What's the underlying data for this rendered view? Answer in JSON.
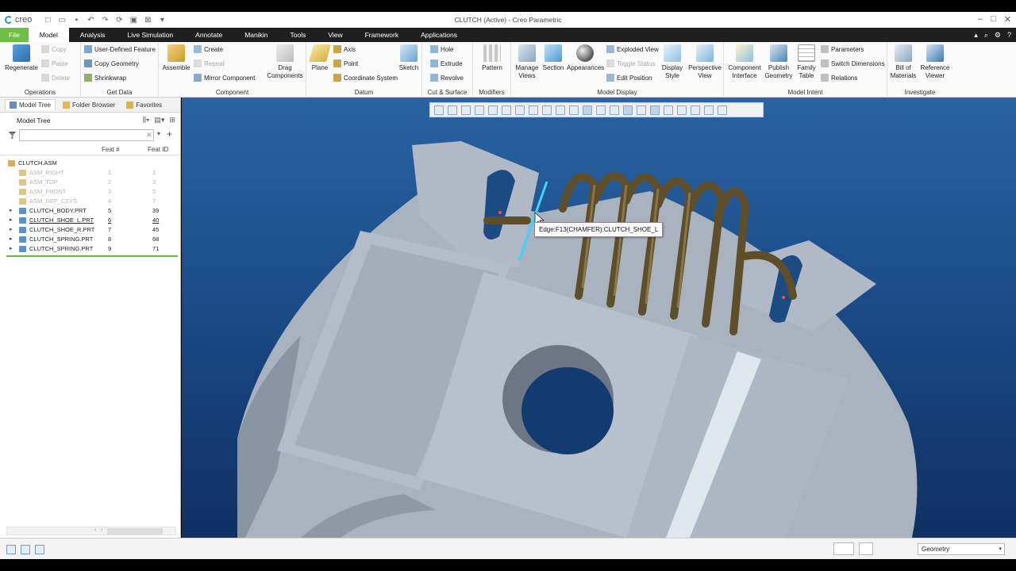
{
  "app": {
    "logo_text": "creo",
    "window_title": "CLUTCH (Active) - Creo Parametric"
  },
  "tabs": [
    "File",
    "Model",
    "Analysis",
    "Live Simulation",
    "Annotate",
    "Manikin",
    "Tools",
    "View",
    "Framework",
    "Applications"
  ],
  "active_tab": "Model",
  "ribbon": {
    "operations": {
      "label": "Operations",
      "regenerate": "Regenerate",
      "copy": "Copy",
      "paste": "Paste",
      "delete": "Delete"
    },
    "get_data": {
      "label": "Get Data",
      "udf": "User-Defined Feature",
      "copy_geometry": "Copy Geometry",
      "shrinkwrap": "Shrinkwrap"
    },
    "component": {
      "label": "Component",
      "assemble": "Assemble",
      "create": "Create",
      "repeat": "Repeat",
      "mirror": "Mirror Component",
      "drag": "Drag Components"
    },
    "datum": {
      "label": "Datum",
      "plane": "Plane",
      "axis": "Axis",
      "point": "Point",
      "csys": "Coordinate System",
      "sketch": "Sketch"
    },
    "cut_surface": {
      "label": "Cut & Surface",
      "hole": "Hole",
      "extrude": "Extrude",
      "revolve": "Revolve"
    },
    "modifiers": {
      "label": "Modifiers",
      "pattern": "Pattern"
    },
    "model_display": {
      "label": "Model Display",
      "manage_views": "Manage Views",
      "section": "Section",
      "appearances": "Appearances",
      "exploded_view": "Exploded View",
      "toggle_status": "Toggle Status",
      "edit_position": "Edit Position",
      "display_style": "Display Style",
      "perspective_view": "Perspective View"
    },
    "model_intent": {
      "label": "Model Intent",
      "component_interface": "Component Interface",
      "publish_geometry": "Publish Geometry",
      "family_table": "Family Table",
      "parameters": "Parameters",
      "switch_dimensions": "Switch Dimensions",
      "relations": "Relations"
    },
    "investigate": {
      "label": "Investigate",
      "bom": "Bill of Materials",
      "reference_viewer": "Reference Viewer"
    }
  },
  "nav_tabs": [
    "Model Tree",
    "Folder Browser",
    "Favorites"
  ],
  "model_tree": {
    "title": "Model Tree",
    "filter_placeholder": "",
    "columns": [
      "Feat #",
      "Feat ID"
    ],
    "rows": [
      {
        "name": "CLUTCH.ASM",
        "feat": "",
        "id": "",
        "kind": "asm",
        "expand": ""
      },
      {
        "name": "ASM_RIGHT",
        "feat": "1",
        "id": "1",
        "kind": "datum",
        "expand": ""
      },
      {
        "name": "ASM_TOP",
        "feat": "2",
        "id": "3",
        "kind": "datum",
        "expand": ""
      },
      {
        "name": "ASM_FRONT",
        "feat": "3",
        "id": "5",
        "kind": "datum",
        "expand": ""
      },
      {
        "name": "ASM_DEF_CSYS",
        "feat": "4",
        "id": "7",
        "kind": "datum",
        "expand": ""
      },
      {
        "name": "CLUTCH_BODY.PRT",
        "feat": "5",
        "id": "39",
        "kind": "part",
        "expand": "▸"
      },
      {
        "name": "CLUTCH_SHOE_L.PRT",
        "feat": "6",
        "id": "40",
        "kind": "part",
        "expand": "▸"
      },
      {
        "name": "CLUTCH_SHOE_R.PRT",
        "feat": "7",
        "id": "45",
        "kind": "part",
        "expand": "▸"
      },
      {
        "name": "CLUTCH_SPRING.PRT",
        "feat": "8",
        "id": "68",
        "kind": "part",
        "expand": "▸"
      },
      {
        "name": "CLUTCH_SPRING.PRT",
        "feat": "9",
        "id": "71",
        "kind": "part",
        "expand": "▸"
      }
    ]
  },
  "viewport": {
    "tooltip": "Edge:F13(CHAMFER):CLUTCH_SHOE_L"
  },
  "status_bar": {
    "selection_filter": "Geometry"
  },
  "colors": {
    "file_tab": "#6fbe44",
    "tab_bar": "#1f1f1f",
    "viewport_top": "#2a63a2",
    "viewport_bottom": "#0f2f63",
    "part_gray": "#a9b3c0",
    "spring": "#5f4e2a"
  }
}
